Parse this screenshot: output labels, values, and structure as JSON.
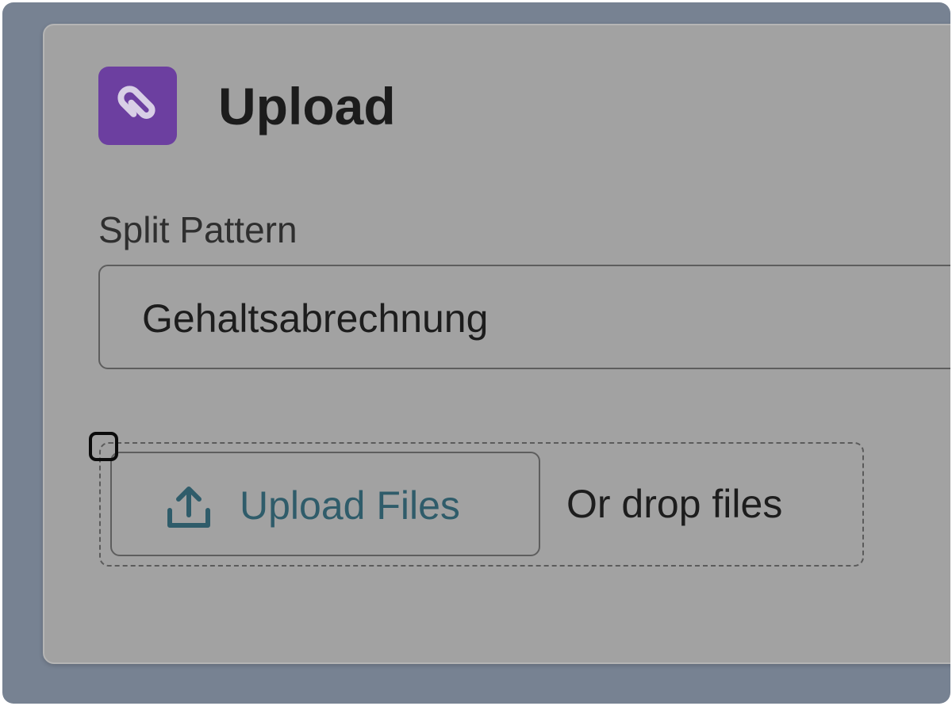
{
  "header": {
    "icon": "paperclip-icon",
    "title": "Upload",
    "icon_color": "#6c3fa0"
  },
  "split_pattern": {
    "label": "Split Pattern",
    "value": "Gehaltsabrechnung"
  },
  "upload": {
    "button_icon": "upload-icon",
    "button_label": "Upload Files",
    "drop_text": "Or drop files",
    "accent_color": "#2f5c6a"
  }
}
